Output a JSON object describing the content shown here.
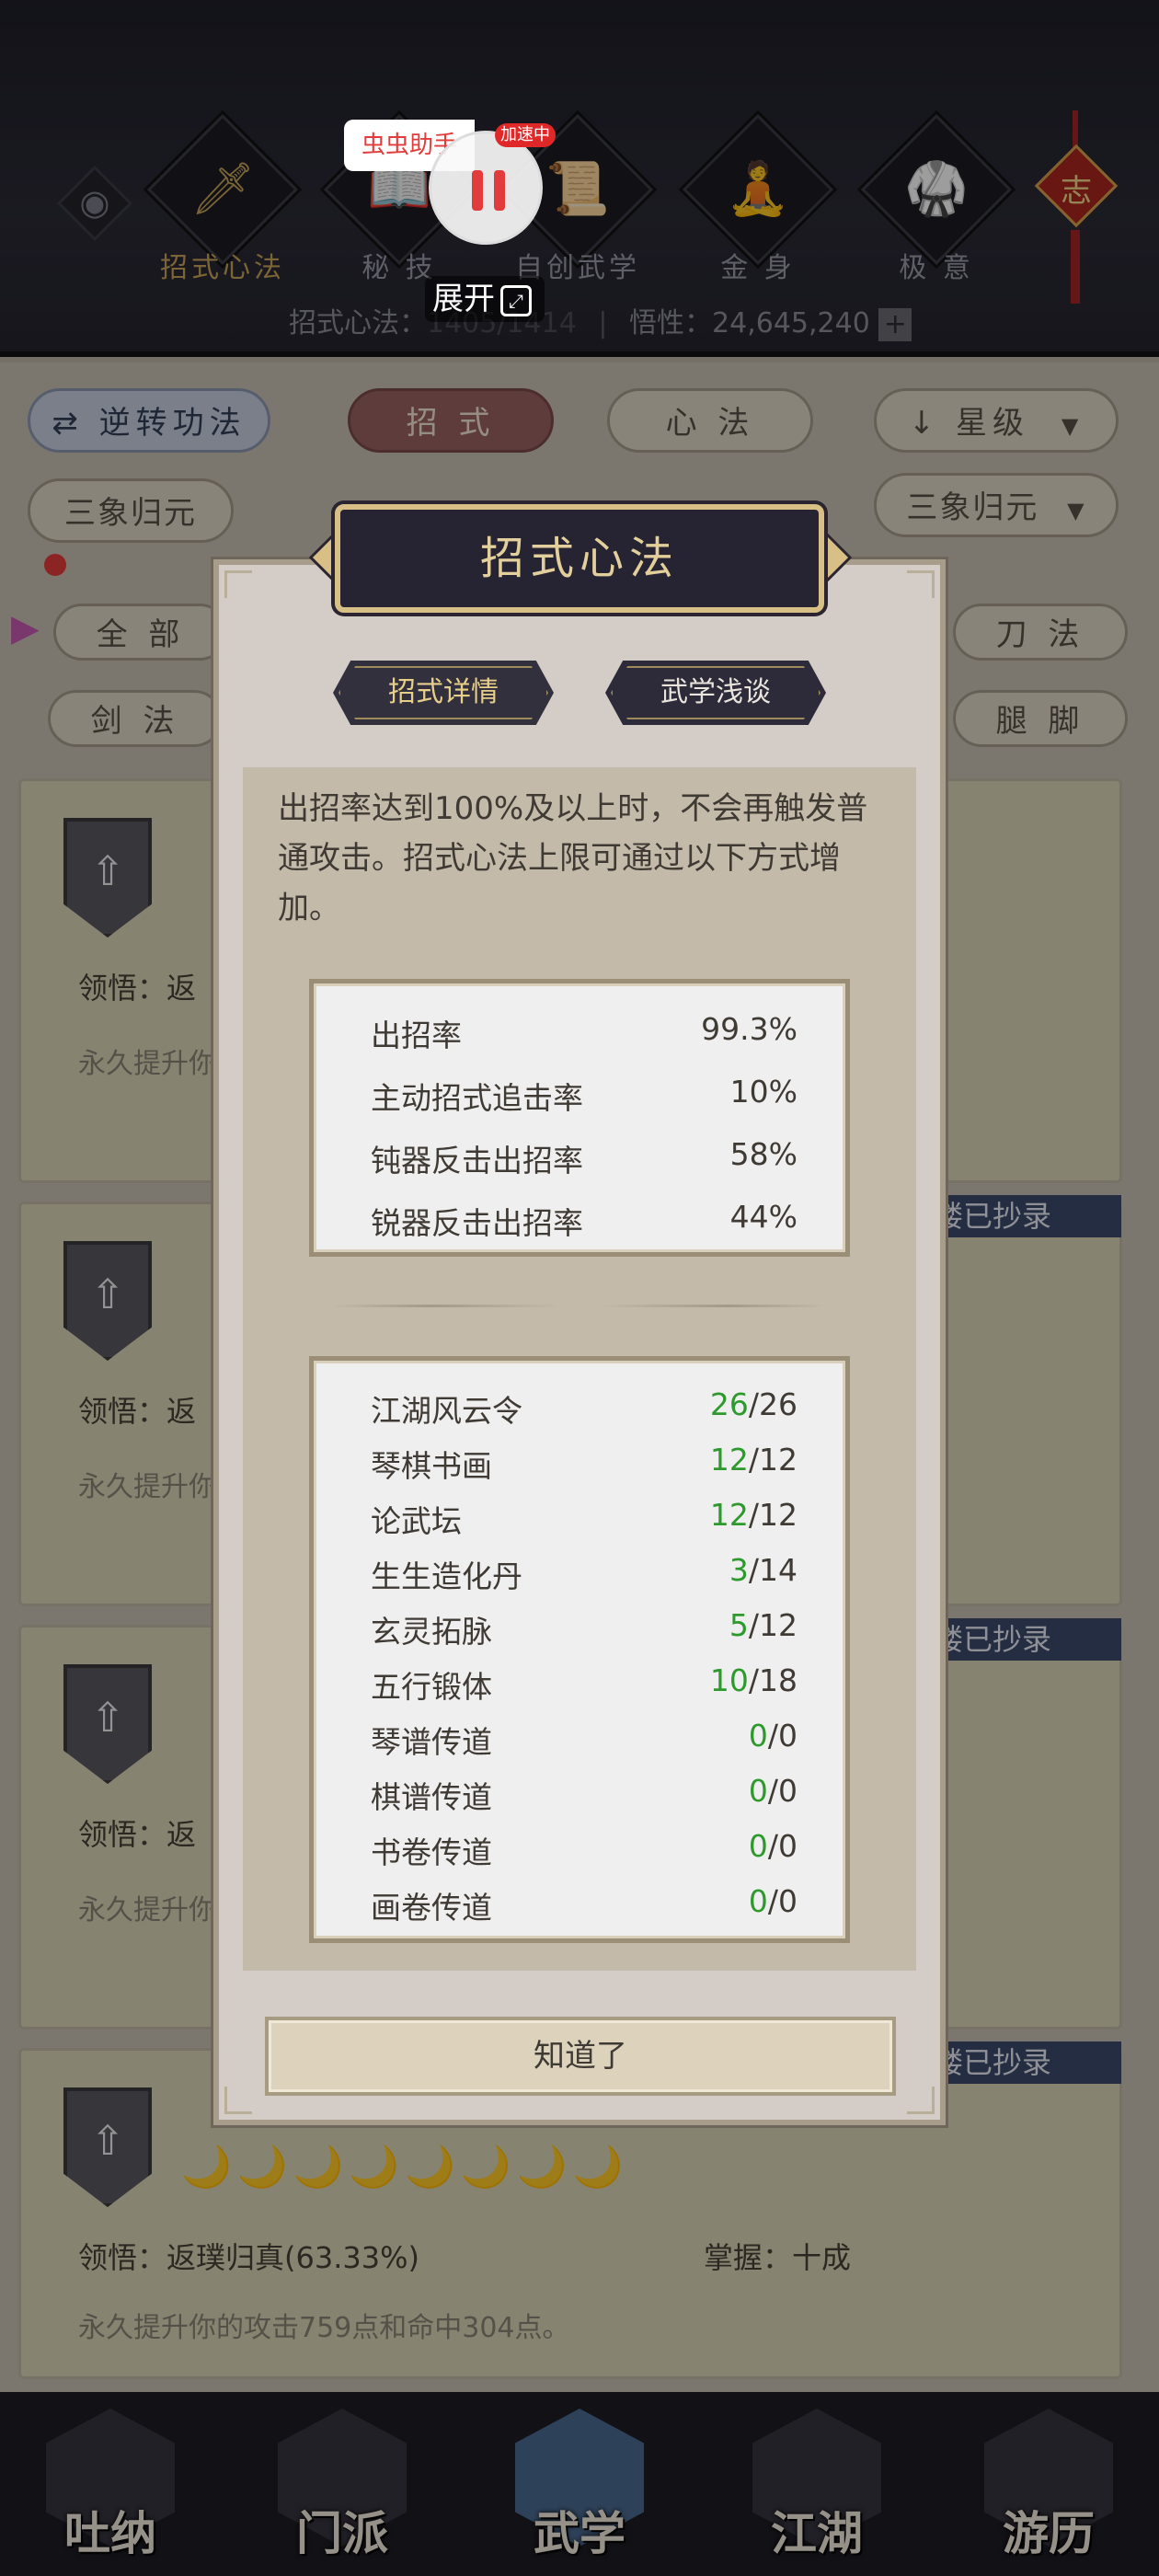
{
  "header": {
    "tabs": [
      {
        "label": "招式心法",
        "icon": "sword-icon",
        "glyph": "🗡",
        "active": true
      },
      {
        "label": "秘 技",
        "icon": "scroll-book-icon",
        "glyph": "📖",
        "active": false
      },
      {
        "label": "自创武学",
        "icon": "scroll-brush-icon",
        "glyph": "📜",
        "active": false
      },
      {
        "label": "金 身",
        "icon": "meditating-figure-icon",
        "glyph": "🧘",
        "active": false
      },
      {
        "label": "极 意",
        "icon": "fighter-stance-icon",
        "glyph": "🥋",
        "active": false
      }
    ],
    "eye_glyph": "◉",
    "knot_char": "志",
    "stat_prefix": "招式心法：",
    "stat_value_hidden": "1405/1414",
    "stat_wisdom_label": "悟性：",
    "stat_wisdom_value": "24,645,240",
    "stat_plus": "+"
  },
  "helper": {
    "tag": "虫虫助手",
    "badge": "加速中",
    "expand": "展开",
    "expand_glyph": "⤢"
  },
  "filters": {
    "reverse": "逆转功法",
    "reverse_glyph": "⇄",
    "tab_moves": "招 式",
    "tab_heart": "心 法",
    "sort": "星级",
    "sort_glyph": "↓",
    "dropdown_glyph": "▼",
    "left_set": "三象归元",
    "right_set": "三象归元",
    "cat_all": "全 部",
    "cat_sword": "剑 法",
    "cat_blade": "刀 法",
    "cat_leg": "腿 脚"
  },
  "cards": [
    {
      "learn": "领悟：返",
      "desc": "永久提升你",
      "copied": ""
    },
    {
      "learn": "领悟：返",
      "desc": "永久提升你",
      "copied": "楼已抄录"
    },
    {
      "learn": "领悟：返",
      "desc": "永久提升你",
      "copied": "楼已抄录"
    },
    {
      "learn": "领悟：返璞归真(63.33%)",
      "master": "掌握：十成",
      "desc": "永久提升你的攻击759点和命中304点。",
      "copied": "楼已抄录",
      "moons": "🌙🌙🌙🌙🌙🌙🌙🌙"
    }
  ],
  "card_shield_glyph": "⇧",
  "modal": {
    "title": "招式心法",
    "tab_detail": "招式详情",
    "tab_talk": "武学浅谈",
    "intro": "出招率达到100%及以上时，不会再触发普通攻击。招式心法上限可通过以下方式增加。",
    "rates": [
      {
        "label": "出招率",
        "value": "99.3%"
      },
      {
        "label": "主动招式追击率",
        "value": "10%"
      },
      {
        "label": "钝器反击出招率",
        "value": "58%"
      },
      {
        "label": "锐器反击出招率",
        "value": "44%"
      }
    ],
    "sources": [
      {
        "label": "江湖风云令",
        "have": "26",
        "sep": "/",
        "max": "26"
      },
      {
        "label": "琴棋书画",
        "have": "12",
        "sep": "/",
        "max": "12"
      },
      {
        "label": "论武坛",
        "have": "12",
        "sep": "/",
        "max": "12"
      },
      {
        "label": "生生造化丹",
        "have": "3",
        "sep": "/",
        "max": "14"
      },
      {
        "label": "玄灵拓脉",
        "have": "5",
        "sep": "/",
        "max": "12"
      },
      {
        "label": "五行锻体",
        "have": "10",
        "sep": "/",
        "max": "18"
      },
      {
        "label": "琴谱传道",
        "have": "0",
        "sep": "/",
        "max": "0"
      },
      {
        "label": "棋谱传道",
        "have": "0",
        "sep": "/",
        "max": "0"
      },
      {
        "label": "书卷传道",
        "have": "0",
        "sep": "/",
        "max": "0"
      },
      {
        "label": "画卷传道",
        "have": "0",
        "sep": "/",
        "max": "0"
      }
    ],
    "ok": "知道了"
  },
  "bottom_nav": [
    {
      "label": "吐纳",
      "icon": "meditation-monk-icon",
      "active": false
    },
    {
      "label": "门派",
      "icon": "sect-flags-icon",
      "active": false
    },
    {
      "label": "武学",
      "icon": "martial-books-icon",
      "active": true
    },
    {
      "label": "江湖",
      "icon": "bamboo-hat-icon",
      "active": false
    },
    {
      "label": "游历",
      "icon": "white-horse-icon",
      "active": false
    }
  ],
  "colors": {
    "accent_gold": "#c7a35a",
    "value_green": "#2e9a2e",
    "modal_title_bg": "#262432",
    "helper_red": "#e23b3b"
  }
}
